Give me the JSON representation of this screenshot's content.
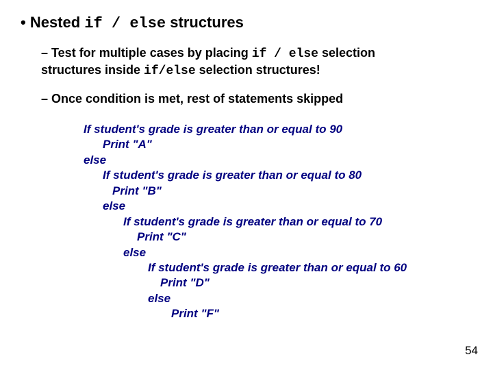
{
  "heading": {
    "bullet": "•",
    "prefix": "Nested ",
    "code": "if / else",
    "suffix": " structures"
  },
  "sub1": {
    "dash": "–",
    "t1": " Test for multiple cases by placing ",
    "c1": "if / else",
    "t2": " selection structures inside ",
    "c2": "if/else",
    "t3": " selection structures!"
  },
  "sub2": {
    "dash": "–",
    "text": " Once condition is met, rest of statements skipped"
  },
  "pseudo": [
    "If student's grade is greater than or equal to 90",
    "Print \"A\"",
    "else",
    "If student's grade is greater than or equal to 80",
    "Print \"B\"",
    "else",
    "If student's grade is greater than or equal to 70",
    "Print \"C\"",
    "else",
    "If student's grade is greater than or equal to 60",
    "Print \"D\"",
    "else",
    "Print \"F\""
  ],
  "page_number": "54"
}
